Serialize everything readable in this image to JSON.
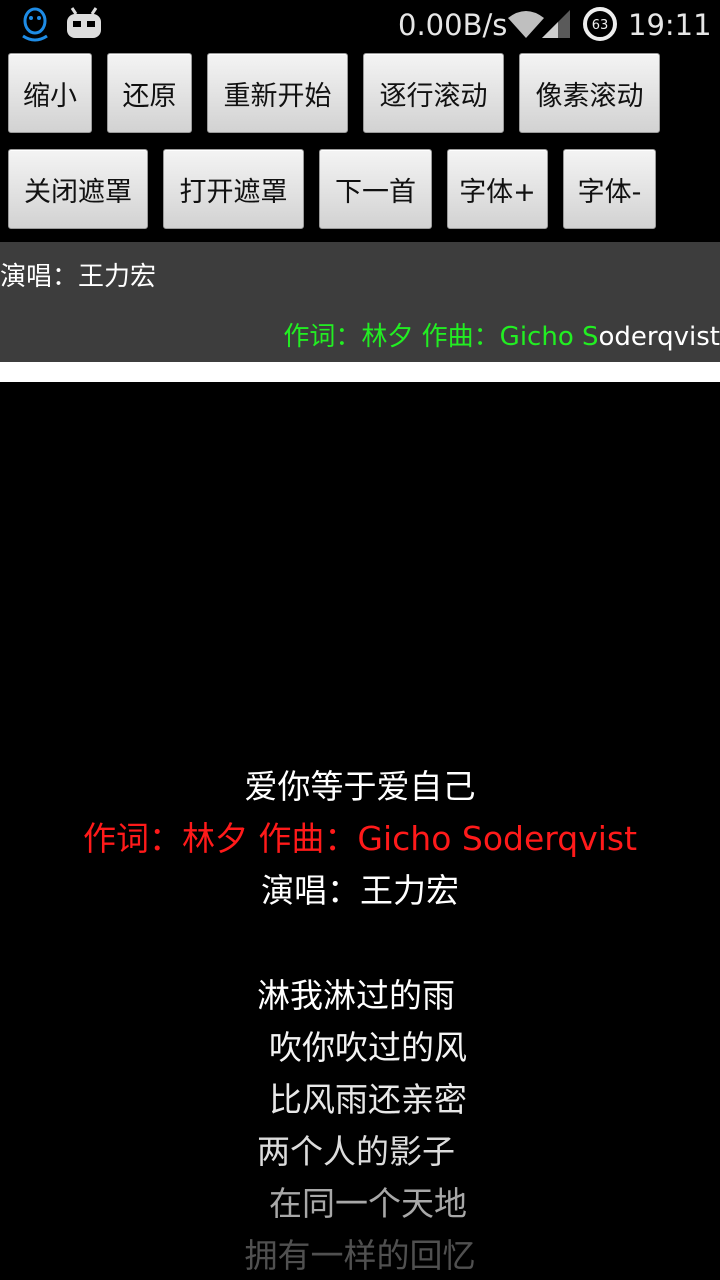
{
  "statusbar": {
    "net_speed": "0.00B/s",
    "battery_level": "63",
    "time": "19:11",
    "icons": [
      "qq-penguin-icon",
      "cyanogen-droid-icon",
      "wifi-icon",
      "signal-icon",
      "battery-ring-icon"
    ]
  },
  "buttons_row1": [
    "缩小",
    "还原",
    "重新开始",
    "逐行滚动",
    "像素滚动"
  ],
  "buttons_row2": [
    "关闭遮罩",
    "打开遮罩",
    "下一首",
    "字体+",
    "字体-"
  ],
  "panel": {
    "singer": "演唱：王力宏",
    "credit_highlighted": "作词：林夕 作曲：Gicho S",
    "credit_rest": "oderqvist"
  },
  "lyrics": {
    "title": "爱你等于爱自己",
    "credit": "作词：林夕 作曲：Gicho Soderqvist",
    "singer": "演唱：王力宏",
    "lines": [
      "淋我淋过的雨",
      "吹你吹过的风",
      "比风雨还亲密",
      "两个人的影子",
      "在同一个天地",
      "拥有一样的回忆"
    ]
  },
  "colors": {
    "highlight_green": "#22ee22",
    "current_red": "#ff1a1a",
    "panel_gray": "#3d3d3d",
    "qq_blue": "#1e8ce6"
  }
}
